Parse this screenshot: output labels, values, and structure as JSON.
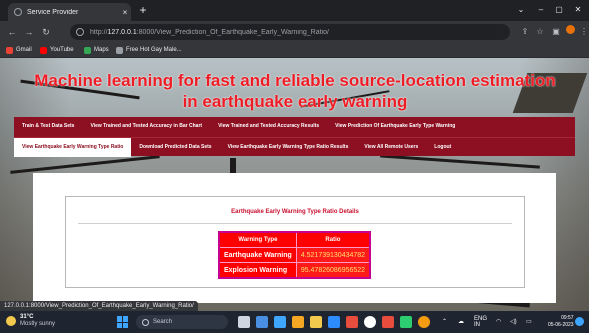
{
  "browser": {
    "tab_title": "Service Provider",
    "tab_close": "×",
    "new_tab": "+",
    "url_host": "127.0.0.1",
    "url_rest": ":8000/View_Prediction_Of_Earthquake_Early_Warning_Ratio/",
    "url_prefix": "http://",
    "bookmarks": [
      "Gmail",
      "YouTube",
      "Maps",
      "Free Hot Gay Male..."
    ]
  },
  "site": {
    "title": "Machine learning for fast and reliable source-location estimation in earthquake early warning"
  },
  "menu": {
    "row1": [
      "Train & Test Data Sets",
      "View Trained and Tested Accuracy in Bar Chart",
      "View Trained and Tested Accuracy Results",
      "View Prediction Of Earthquake Early Type Warning"
    ],
    "row2": [
      "View Earthquake Early Warning Type Ratio",
      "Download Predicted Data Sets",
      "View Earthquake Early Warning Type Ratio Results",
      "View All Remote Users",
      "Logout"
    ]
  },
  "details": {
    "title": "Earthquake Early Warning Type Ratio Details",
    "headers": [
      "Warning Type",
      "Ratio"
    ],
    "rows": [
      {
        "type": "Earthquake Warning",
        "ratio": "4.521739130434782"
      },
      {
        "type": "Explosion Warning",
        "ratio": "95.47826086956522"
      }
    ]
  },
  "status_bar_url": "127.0.0.1:8000/View_Prediction_Of_Earthquake_Early_Warning_Ratio/",
  "taskbar": {
    "weather_temp": "31°C",
    "weather_desc": "Mostly sunny",
    "search_label": "Search",
    "tray_lang": "ENG",
    "tray_region": "IN",
    "time": "09:57",
    "date": "05-06-2023"
  },
  "colors": {
    "menu_bg": "#8c1022",
    "title_red": "#ee1c25",
    "table_header": "#ff0000",
    "table_value": "#ffe066"
  }
}
